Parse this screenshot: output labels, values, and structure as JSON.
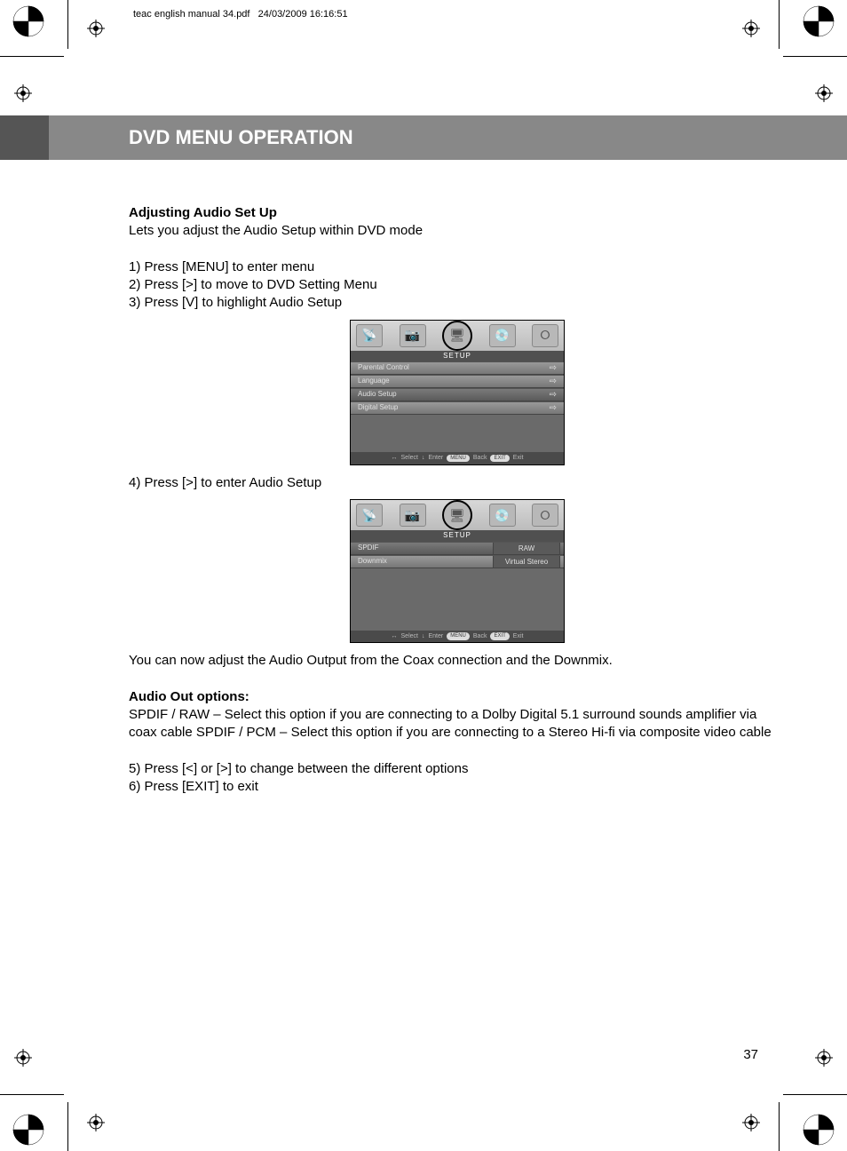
{
  "header": {
    "filename": "teac english manual 34.pdf",
    "timestamp": "24/03/2009   16:16:51"
  },
  "title": "DVD MENU OPERATION",
  "sec1_head": "Adjusting Audio Set Up",
  "sec1_body": "Lets you adjust the Audio Setup within DVD mode",
  "steps_a": {
    "s1": "1) Press [MENU] to enter menu",
    "s2": "2) Press [>] to move to DVD Setting Menu",
    "s3": "3) Press [V] to highlight Audio Setup"
  },
  "ui1": {
    "setup": "SETUP",
    "rows": {
      "r1": "Parental Control",
      "r2": "Language",
      "r3": "Audio Setup",
      "r4": "Digital Setup"
    },
    "footer": {
      "select": "Select",
      "enter": "Enter",
      "menu": "MENU",
      "back": "Back",
      "exit": "EXIT",
      "exit2": "Exit"
    }
  },
  "step4": "4) Press [>] to enter Audio Setup",
  "ui2": {
    "setup": "SETUP",
    "rows": {
      "r1": "SPDIF",
      "v1": "RAW",
      "r2": "Downmix",
      "v2": "Virtual Stereo"
    },
    "footer": {
      "select": "Select",
      "enter": "Enter",
      "menu": "MENU",
      "back": "Back",
      "exit": "EXIT",
      "exit2": "Exit"
    }
  },
  "post_ui2": "You can now adjust the Audio Output from the Coax connection and the Downmix.",
  "sec2_head": "Audio Out options:",
  "sec2_body": "SPDIF / RAW – Select this option if you are connecting to a Dolby Digital 5.1 surround sounds amplifier via coax cable SPDIF / PCM – Select this option if you are connecting to a Stereo Hi-fi via composite video cable",
  "steps_b": {
    "s5": "5) Press [<] or [>] to change between the different options",
    "s6": "6) Press [EXIT] to exit"
  },
  "page_no": "37"
}
